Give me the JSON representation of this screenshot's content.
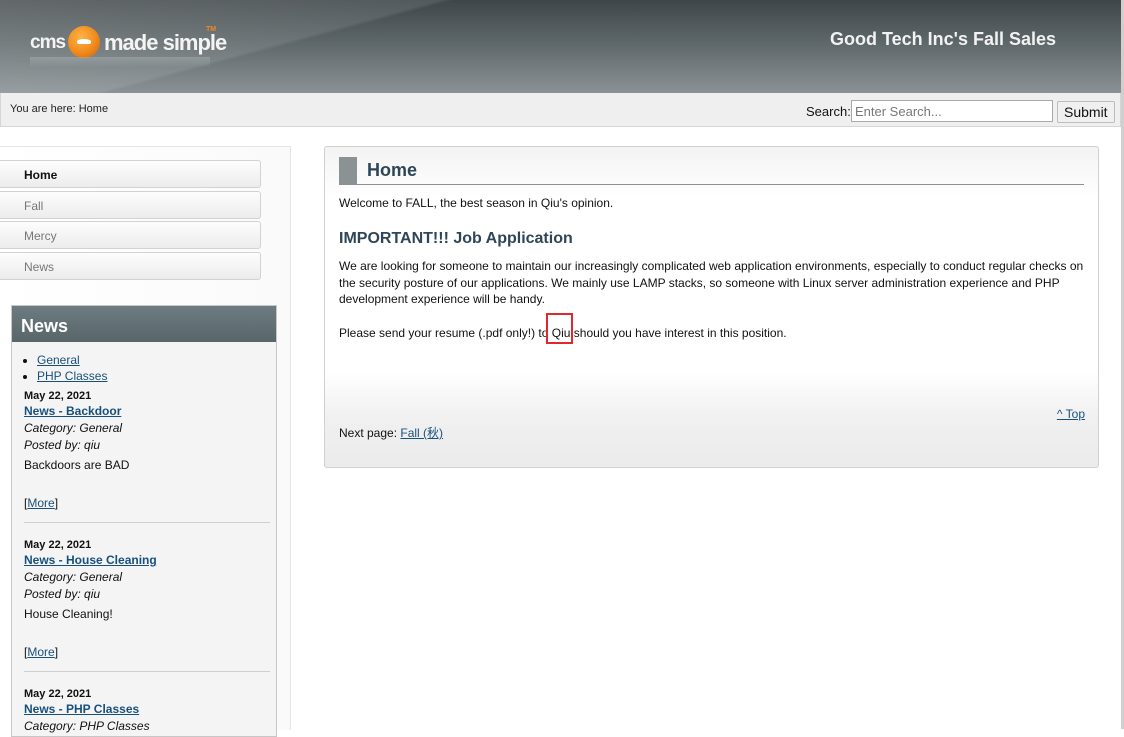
{
  "header": {
    "logo_parts": {
      "cms": "cms",
      "made": "made simple",
      "tm": "TM"
    },
    "site_name": "Good Tech Inc's Fall Sales"
  },
  "breadcrumb": {
    "label": "You are here:",
    "current": "Home"
  },
  "search": {
    "label": "Search:",
    "placeholder": "Enter Search...",
    "submit": "Submit"
  },
  "nav": {
    "items": [
      {
        "label": "Home",
        "active": true
      },
      {
        "label": "Fall",
        "active": false
      },
      {
        "label": "Mercy",
        "active": false
      },
      {
        "label": "News",
        "active": false
      }
    ]
  },
  "news": {
    "title": "News",
    "categories": [
      "General",
      "PHP Classes"
    ],
    "items": [
      {
        "date": "May 22, 2021",
        "title": "News - Backdoor",
        "category": "Category: General",
        "posted": "Posted by: qiu",
        "summary": "Backdoors are BAD",
        "more": "More"
      },
      {
        "date": "May 22, 2021",
        "title": "News - House Cleaning",
        "category": "Category: General",
        "posted": "Posted by: qiu",
        "summary": "House Cleaning!",
        "more": "More"
      },
      {
        "date": "May 22, 2021",
        "title": "News - PHP Classes",
        "category": "Category: PHP Classes",
        "posted": "",
        "summary": "",
        "more": ""
      }
    ]
  },
  "content": {
    "title": "Home",
    "welcome": "Welcome to FALL, the best season in Qiu's opinion.",
    "subheading": "IMPORTANT!!! Job Application",
    "para1": "We are looking for someone to maintain our increasingly complicated web application environments, especially to conduct regular checks on the security posture of our applications. We mainly use LAMP stacks, so someone with Linux server administration experience and PHP development experience will be handy.",
    "para2_before": "Please send your resume (.pdf only!) to ",
    "para2_name": "Qiu",
    "para2_after": " should you have interest in this position.",
    "top_link": "^ Top",
    "next_label": "Next page:",
    "next_link": "Fall (秋)"
  },
  "colors": {
    "header_dark": "#3f4649",
    "heading": "#2e4657",
    "link": "#18507c",
    "highlight": "#e0282e",
    "logo_orange": "#f08a1c"
  }
}
